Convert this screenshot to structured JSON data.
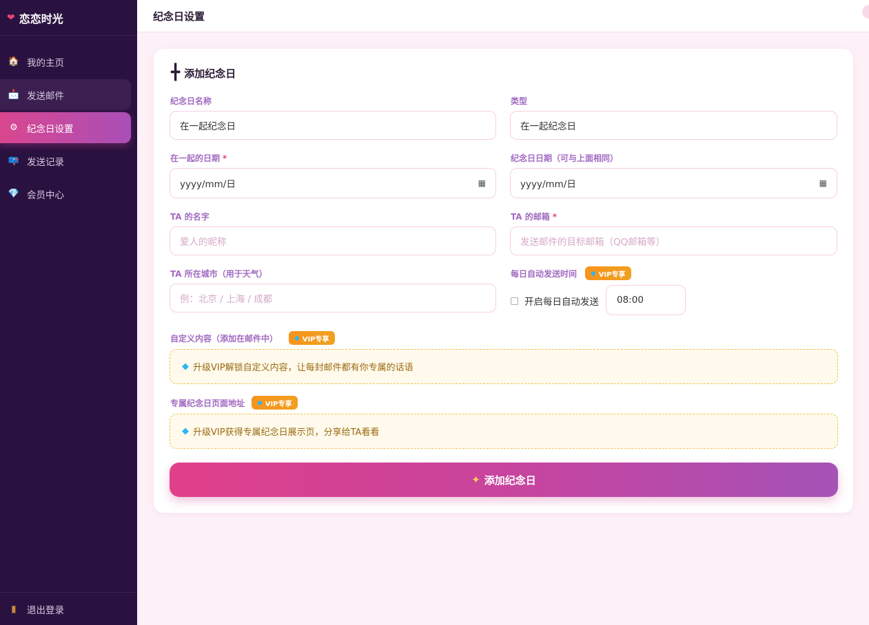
{
  "app": {
    "brand": "恋恋时光",
    "heart_icon": "heart-icon"
  },
  "sidebar": {
    "items": [
      {
        "label": "我的主页",
        "icon": "home-icon",
        "glyph": "🏠"
      },
      {
        "label": "发送邮件",
        "icon": "mail-icon",
        "glyph": "📩"
      },
      {
        "label": "纪念日设置",
        "icon": "gear-icon",
        "glyph": "⚙"
      },
      {
        "label": "发送记录",
        "icon": "mailbox-icon",
        "glyph": "📪"
      },
      {
        "label": "会员中心",
        "icon": "diamond-icon",
        "glyph": "💎"
      }
    ],
    "active_index": 2,
    "logout": {
      "label": "退出登录",
      "icon": "door-icon",
      "glyph": "▮"
    }
  },
  "header": {
    "title": "纪念日设置"
  },
  "form": {
    "title": "添加纪念日",
    "name_label": "纪念日名称",
    "name_value": "在一起纪念日",
    "type_label": "类型",
    "type_value": "在一起纪念日",
    "together_date_label": "在一起的日期",
    "together_date_value": "yyyy/mm/日",
    "anniv_date_label": "纪念日日期（可与上面相同）",
    "anniv_date_value": "yyyy/mm/日",
    "ta_name_label": "TA 的名字",
    "ta_name_placeholder": "爱人的昵称",
    "ta_email_label": "TA 的邮箱",
    "ta_email_placeholder": "发送邮件的目标邮箱（QQ邮箱等）",
    "city_label": "TA 所在城市（用于天气）",
    "city_placeholder": "例：北京 / 上海 / 成都",
    "auto_send_label": "每日自动发送时间",
    "auto_send_checkbox": "开启每日自动发送",
    "auto_send_checked": false,
    "auto_send_time": "08:00",
    "custom_label": "自定义内容（添加在邮件中）",
    "custom_vip_text": "升级VIP解锁自定义内容，让每封邮件都有你专属的话语",
    "page_label": "专属纪念日页面地址",
    "page_vip_text": "升级VIP获得专属纪念日展示页，分享给TA看看",
    "vip_badge": "VIP专享",
    "required_mark": "*",
    "submit": "添加纪念日"
  },
  "colors": {
    "sidebar_bg": "#2a1240",
    "accent_pink": "#e0408a",
    "accent_purple": "#a553b8",
    "label_purple": "#a26bc2",
    "vip_orange": "#f7941d"
  }
}
